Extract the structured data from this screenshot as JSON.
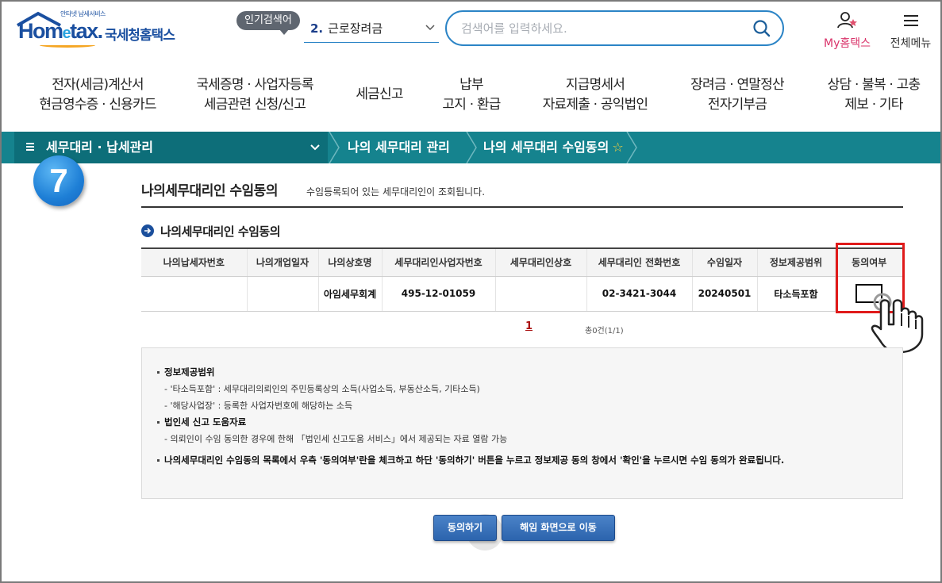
{
  "header": {
    "logo_sub": "안타넷 납세서비스",
    "logo_text": "Hometax",
    "logo_kr": "국세청홈택스",
    "popular_badge": "인기검색어",
    "popular_rank": "2.",
    "popular_keyword": "근로장려금",
    "search_placeholder": "검색어를 입력하세요.",
    "my_hometax": "My홈택스",
    "all_menu": "전체메뉴"
  },
  "gnb": [
    {
      "line1": "전자(세금)계산서",
      "line2": "현금영수증 · 신용카드"
    },
    {
      "line1": "국세증명 · 사업자등록",
      "line2": "세금관련 신청/신고"
    },
    {
      "line1": "세금신고",
      "line2": ""
    },
    {
      "line1": "납부",
      "line2": "고지 · 환급"
    },
    {
      "line1": "지급명세서",
      "line2": "자료제출 · 공익법인"
    },
    {
      "line1": "장려금 · 연말정산",
      "line2": "전자기부금"
    },
    {
      "line1": "상담 · 불복 · 고충",
      "line2": "제보 · 기타"
    }
  ],
  "breadcrumb": {
    "first": "세무대리 · 납세관리",
    "second": "나의 세무대리 관리",
    "third": "나의 세무대리 수임동의"
  },
  "step_number": "7",
  "page": {
    "title": "나의세무대리인 수임동의",
    "desc": "수임등록되어 있는 세무대리인이 조회됩니다.",
    "section_title": "나의세무대리인 수임동의"
  },
  "table": {
    "headers": [
      "나의납세자번호",
      "나의개업일자",
      "나의상호명",
      "세무대리인사업자번호",
      "세무대리인상호",
      "세무대리인 전화번호",
      "수임일자",
      "정보제공범위",
      "동의여부"
    ],
    "rows": [
      {
        "taxpayer_no": "",
        "open_date": "",
        "my_company": "아임세무회계",
        "agent_biz_no": "495-12-01059",
        "agent_company": "",
        "agent_phone": "02-3421-3044",
        "date": "20240501",
        "scope": "타소득포함"
      }
    ]
  },
  "pager": {
    "current": "1",
    "count": "총0건(1/1)"
  },
  "info": {
    "h1": "정보제공범위",
    "s1": "- '타소득포함' : 세무대리의뢰인의 주민등록상의 소득(사업소득, 부동산소득, 기타소득)",
    "s2": "- '해당사업장' : 등록한 사업자번호에 해당하는 소득",
    "h2": "법인세 신고 도움자료",
    "s3": "- 의뢰인이 수임 동의한 경우에 한해 「법인세 신고도움 서비스」에서 제공되는 자료 열람 가능",
    "note": "나의세무대리인 수임동의 목록에서 우측 '동의여부'란을 체크하고 하단 '동의하기' 버튼을 누르고 정보제공 동의 창에서 '확인'을 누르시면 수임 동의가 완료됩니다."
  },
  "buttons": {
    "agree": "동의하기",
    "cancel": "해임 화면으로 이동"
  },
  "colors": {
    "teal_bar": "#15838e",
    "brand_blue": "#1a4fa0",
    "highlight_red": "#e01b1b",
    "button_blue": "#2c64ad"
  }
}
